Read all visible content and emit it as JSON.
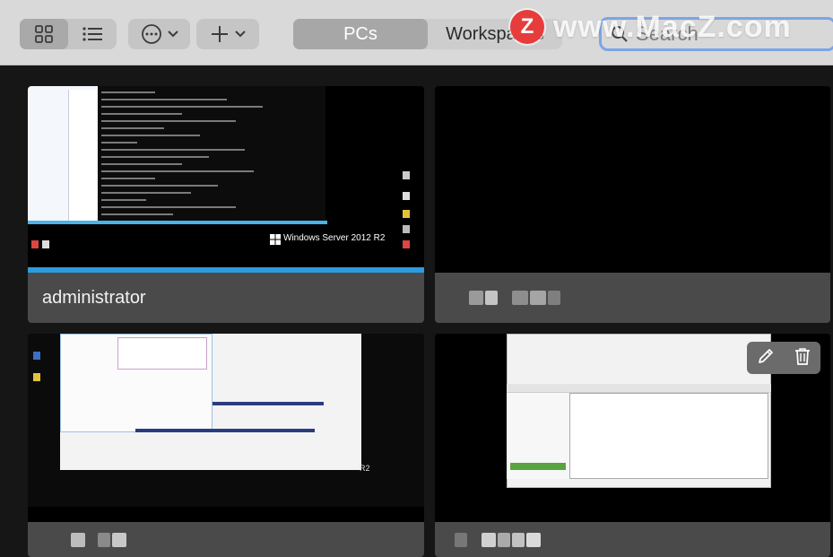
{
  "toolbar": {
    "view_modes": [
      "grid-icon",
      "list-icon"
    ],
    "tabs": [
      {
        "label": "PCs",
        "active": true
      },
      {
        "label": "Workspaces",
        "active": false
      }
    ],
    "search": {
      "value": "Search"
    }
  },
  "watermark": {
    "logo": "Z",
    "text": "www.MacZ.com"
  },
  "cards": [
    {
      "title": "administrator",
      "thumbnail_caption": "Windows Server 2012 R2"
    },
    {
      "title": ""
    },
    {
      "title": "",
      "thumbnail_caption": "R2"
    },
    {
      "title": ""
    }
  ],
  "colors": {
    "accent": "#7aa6e6",
    "toolbar_bg": "#d9d9d9",
    "card_footer": "#4a4a4a",
    "watermark_red": "#e73c3c"
  }
}
